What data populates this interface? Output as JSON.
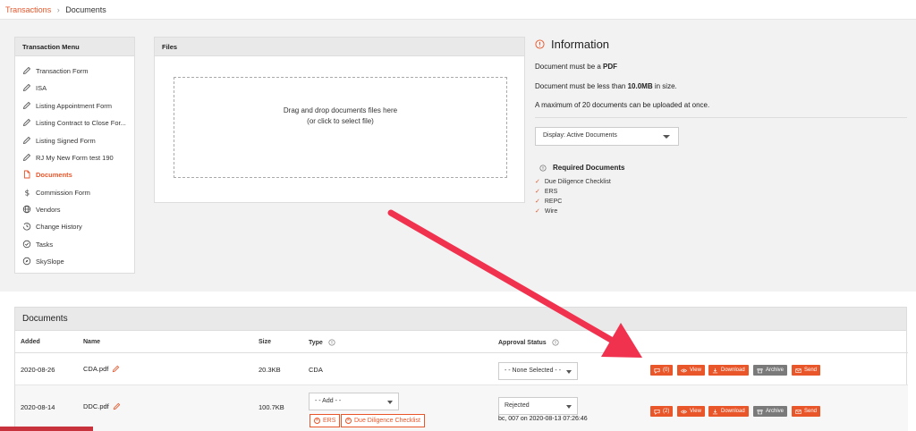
{
  "breadcrumb": {
    "parent": "Transactions",
    "separator": "›",
    "current": "Documents"
  },
  "menu": {
    "title": "Transaction Menu",
    "items": [
      {
        "label": "Transaction Form",
        "icon": "pencil-icon"
      },
      {
        "label": "ISA",
        "icon": "pencil-icon"
      },
      {
        "label": "Listing Appointment Form",
        "icon": "pencil-icon"
      },
      {
        "label": "Listing Contract to Close For...",
        "icon": "pencil-icon"
      },
      {
        "label": "Listing Signed Form",
        "icon": "pencil-icon"
      },
      {
        "label": "RJ My New Form test 190",
        "icon": "pencil-icon"
      },
      {
        "label": "Documents",
        "icon": "document-icon",
        "active": true
      },
      {
        "label": "Commission Form",
        "icon": "dollar-icon"
      },
      {
        "label": "Vendors",
        "icon": "globe-icon"
      },
      {
        "label": "Change History",
        "icon": "history-icon"
      },
      {
        "label": "Tasks",
        "icon": "check-circle-icon"
      },
      {
        "label": "SkySlope",
        "icon": "compass-icon"
      }
    ]
  },
  "files": {
    "title": "Files",
    "drop_line1": "Drag and drop documents files here",
    "drop_line2": "(or click to select file)"
  },
  "info": {
    "title": "Information",
    "line1_prefix": "Document must be a ",
    "line1_bold": "PDF",
    "line2_prefix": "Document must be less than ",
    "line2_bold": "10.0MB",
    "line2_suffix": " in size.",
    "line3": "A maximum of 20 documents can be uploaded at once.",
    "display_select": "Display: Active Documents",
    "required_title": "Required Documents",
    "required": [
      "Due Diligence Checklist",
      "ERS",
      "REPC",
      "Wire"
    ]
  },
  "documents": {
    "title": "Documents",
    "columns": {
      "added": "Added",
      "name": "Name",
      "size": "Size",
      "type": "Type",
      "approval": "Approval Status"
    },
    "rows": [
      {
        "added": "2020-08-26",
        "name": "CDA.pdf",
        "size": "20.3KB",
        "type": "CDA",
        "approval_select": "- - None Selected - -",
        "comments": "(0)"
      },
      {
        "added": "2020-08-14",
        "name": "DDC.pdf",
        "size": "100.7KB",
        "type_select": "- - Add - -",
        "tags": [
          "ERS",
          "Due Diligence Checklist"
        ],
        "approval_select": "Rejected",
        "approval_note": "bc, 007 on 2020-08-13 07:26:46",
        "comments": "(2)"
      }
    ],
    "actions": {
      "view": "View",
      "download": "Download",
      "archive": "Archive",
      "send": "Send"
    }
  },
  "colors": {
    "accent": "#e8562a",
    "arrow": "#f0324f",
    "archive": "#7a7a7a"
  }
}
